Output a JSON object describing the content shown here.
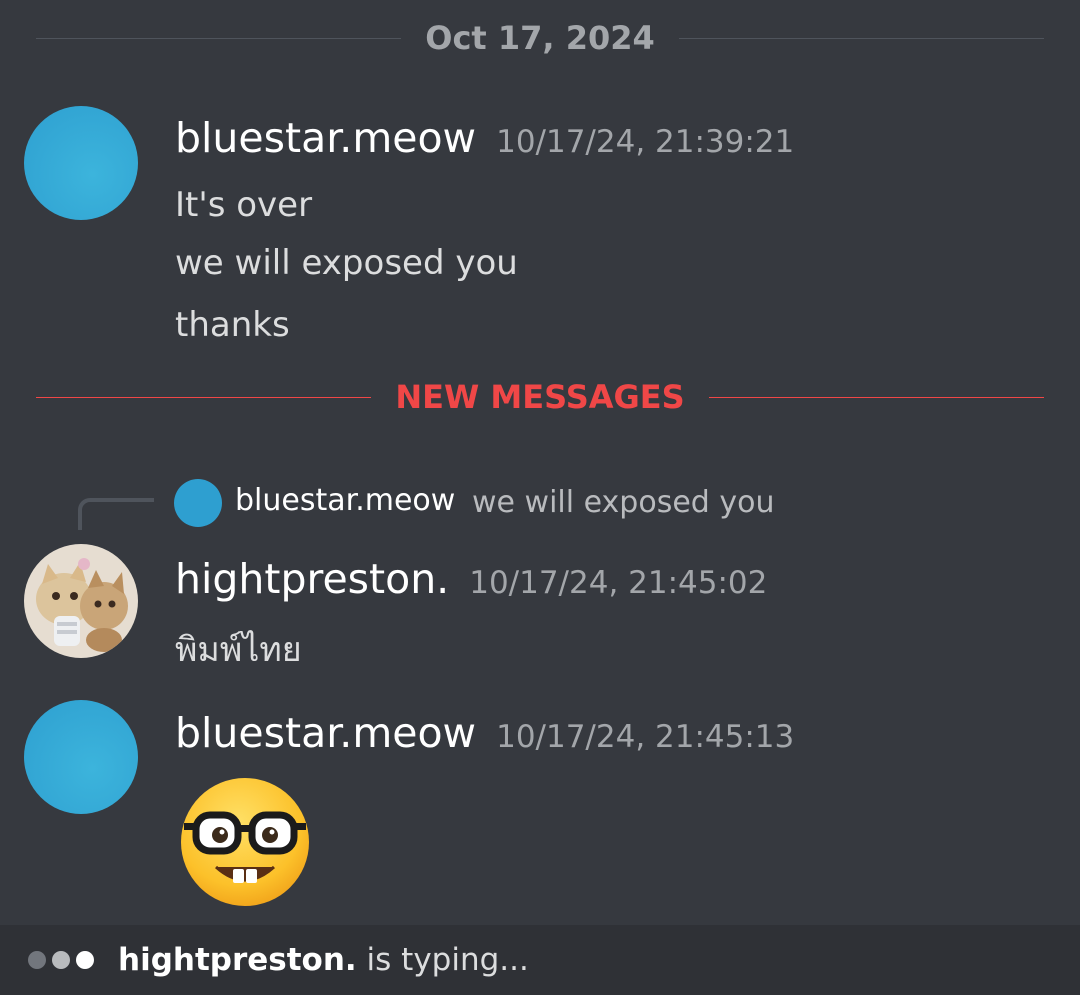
{
  "date_divider": "Oct 17, 2024",
  "new_messages_divider": "NEW MESSAGES",
  "messages": [
    {
      "username": "bluestar.meow",
      "timestamp": "10/17/24, 21:39:21",
      "lines": [
        "It's over",
        "we will exposed you",
        "thanks"
      ]
    },
    {
      "username": "hightpreston.",
      "timestamp": "10/17/24, 21:45:02",
      "reply_to": {
        "username": "bluestar.meow",
        "text": "we will exposed you"
      },
      "lines": [
        "พิมพ์ไทย"
      ]
    },
    {
      "username": "bluestar.meow",
      "timestamp": "10/17/24, 21:45:13",
      "emoji": "nerd-face"
    }
  ],
  "typing": {
    "name": "hightpreston.",
    "suffix": " is typing..."
  },
  "colors": {
    "background": "#36393f",
    "new_messages_red": "#f04747",
    "avatar_blue": "#2e9fd0",
    "typing_bar": "#2f3136"
  }
}
